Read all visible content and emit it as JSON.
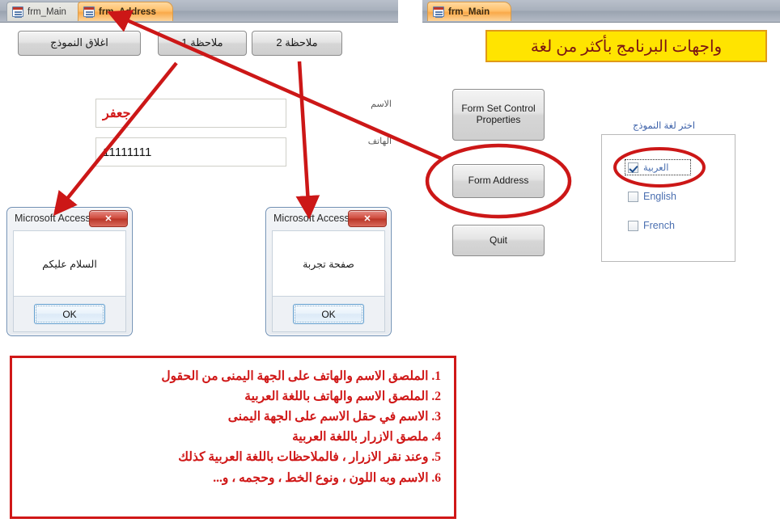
{
  "left_panel": {
    "tabs": [
      {
        "label": "frm_Main",
        "active": false,
        "icon": "access-form-icon"
      },
      {
        "label": "frm_Address",
        "active": true,
        "icon": "access-form-icon"
      }
    ],
    "buttons": [
      {
        "label": "ملاحظة 2"
      },
      {
        "label": "ملاحظة 1"
      },
      {
        "label": "اغلاق النموذج"
      }
    ],
    "fields": [
      {
        "label": "الاسم",
        "value": "جعفر",
        "value_color": "#d21919"
      },
      {
        "label": "الهاتف",
        "value": "11111111",
        "value_color": "#111111"
      }
    ],
    "dialogs": [
      {
        "title": "Microsoft Access",
        "message": "السلام عليكم",
        "ok_label": "OK",
        "close_label": "✕"
      },
      {
        "title": "Microsoft Access",
        "message": "صفحة تجربة",
        "ok_label": "OK",
        "close_label": "✕"
      }
    ]
  },
  "right_panel": {
    "tabs": [
      {
        "label": "frm_Main",
        "active": true,
        "icon": "access-form-icon"
      }
    ],
    "banner": "واجهات البرنامج بأكثر من لغة",
    "buttons": [
      {
        "label": "Form Set Control Properties",
        "highlighted": false
      },
      {
        "label": "Form Address",
        "highlighted": true
      },
      {
        "label": "Quit",
        "highlighted": false
      }
    ],
    "language_group": {
      "title": "اختر لغة النموذج",
      "options": [
        {
          "label": "العربية",
          "checked": true,
          "focused": true,
          "rtl": true
        },
        {
          "label": "English",
          "checked": false,
          "focused": false,
          "rtl": false
        },
        {
          "label": "French",
          "checked": false,
          "focused": false,
          "rtl": false
        }
      ]
    }
  },
  "notes_box": {
    "lines": [
      "1. الملصق الاسم والهاتف على الجهة اليمنى من الحقول",
      "2. الملصق الاسم والهاتف باللغة العربية",
      "3. الاسم في حقل الاسم على الجهة اليمنى",
      "4. ملصق الازرار باللغة العربية",
      "5. وعند نقر الازرار ، فالملاحظات باللغة العربية كذلك",
      "6. الاسم وبه اللون ، ونوع الخط ، وحجمه ، و..."
    ]
  },
  "colors": {
    "annotation_red": "#cc1717",
    "banner_yellow": "#ffe400",
    "banner_border": "#e09a18",
    "banner_text": "#7a1414",
    "notes_red": "#d01818",
    "link_blue": "#4a6fb0"
  }
}
